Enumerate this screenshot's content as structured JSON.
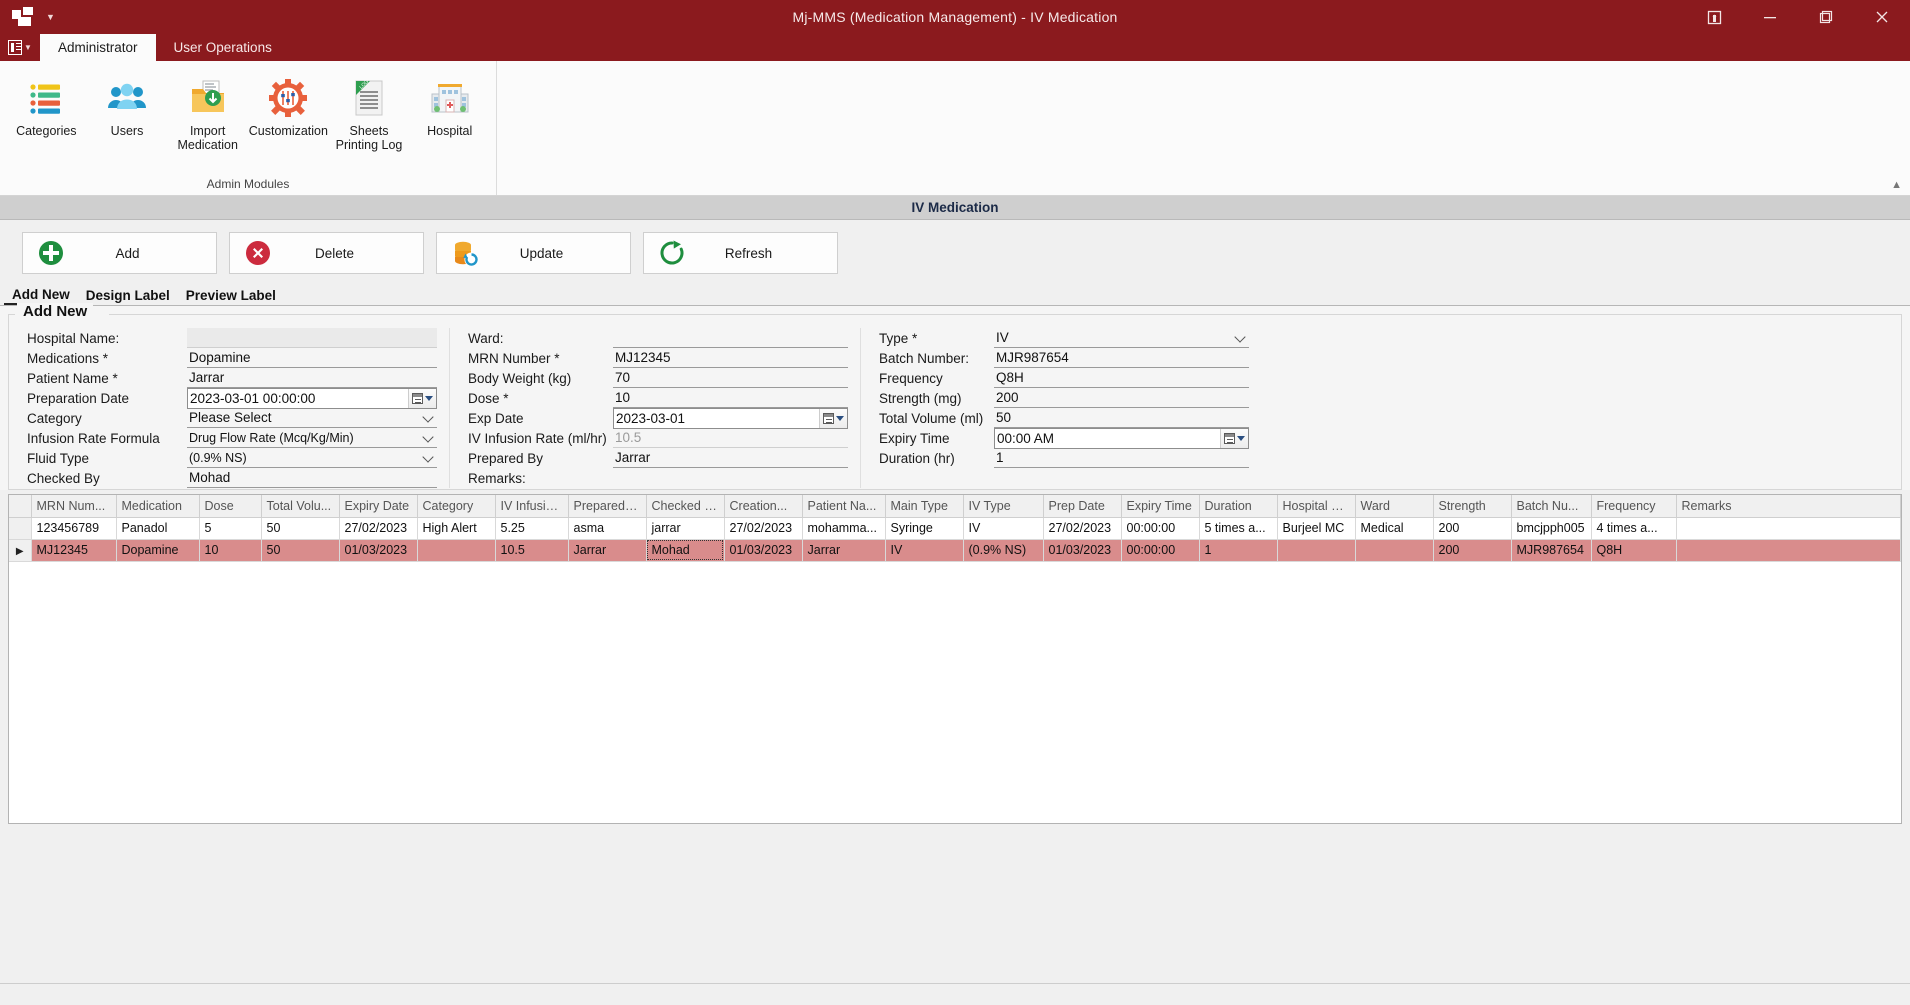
{
  "window": {
    "title": "Mj-MMS (Medication Management) - IV Medication",
    "controls": {
      "restore_down": "restore-down",
      "minimize": "minimize",
      "maximize": "maximize",
      "close": "close"
    }
  },
  "ribbon": {
    "tabs": [
      {
        "label": "Administrator",
        "active": true
      },
      {
        "label": "User Operations",
        "active": false
      }
    ],
    "group_title": "Admin Modules",
    "items": [
      {
        "label": "Categories",
        "icon": "categories-icon"
      },
      {
        "label": "Users",
        "icon": "users-icon"
      },
      {
        "label": "Import\nMedication",
        "line1": "Import",
        "line2": "Medication",
        "icon": "import-medication-icon"
      },
      {
        "label": "Customization",
        "icon": "customization-icon"
      },
      {
        "label": "Sheets\nPrinting Log",
        "line1": "Sheets",
        "line2": "Printing Log",
        "icon": "sheets-printing-log-icon"
      },
      {
        "label": "Hospital",
        "icon": "hospital-icon"
      }
    ]
  },
  "document": {
    "header": "IV Medication"
  },
  "actions": [
    {
      "label": "Add",
      "icon": "add-circle-icon"
    },
    {
      "label": "Delete",
      "icon": "delete-circle-icon"
    },
    {
      "label": "Update",
      "icon": "update-database-icon"
    },
    {
      "label": "Refresh",
      "icon": "refresh-icon"
    }
  ],
  "page_tabs": [
    {
      "label": "Add New",
      "active": true
    },
    {
      "label": "Design Label",
      "active": false
    },
    {
      "label": "Preview Label",
      "active": false
    }
  ],
  "form": {
    "legend": "Add New",
    "col1": [
      {
        "label": "Hospital Name:",
        "value": "",
        "type": "readonly"
      },
      {
        "label": "Medications *",
        "value": "Dopamine",
        "type": "text"
      },
      {
        "label": "Patient Name *",
        "value": "Jarrar",
        "type": "text"
      },
      {
        "label": "Preparation Date",
        "value": "2023-03-01 00:00:00",
        "type": "datetime"
      },
      {
        "label": "Category",
        "value": "Please Select",
        "type": "select"
      },
      {
        "label": "Infusion Rate Formula",
        "value": "Drug Flow Rate (Mcq/Kg/Min)",
        "type": "select-small"
      },
      {
        "label": "Fluid Type",
        "value": "(0.9% NS)",
        "type": "select-small"
      },
      {
        "label": "Checked By",
        "value": "Mohad",
        "type": "text"
      }
    ],
    "col2": [
      {
        "label": "Ward:",
        "value": "",
        "type": "text"
      },
      {
        "label": "MRN Number *",
        "value": "MJ12345",
        "type": "text"
      },
      {
        "label": "Body Weight (kg)",
        "value": "70",
        "type": "text"
      },
      {
        "label": "Dose *",
        "value": "10",
        "type": "text"
      },
      {
        "label": "Exp Date",
        "value": "2023-03-01",
        "type": "datetime"
      },
      {
        "label": "IV Infusion Rate (ml/hr)",
        "value": "10.5",
        "type": "disabled"
      },
      {
        "label": "Prepared By",
        "value": "Jarrar",
        "type": "text"
      },
      {
        "label": "Remarks:",
        "value": "",
        "type": "text"
      }
    ],
    "col3": [
      {
        "label": "Type *",
        "value": "IV",
        "type": "select"
      },
      {
        "label": "Batch Number:",
        "value": "MJR987654",
        "type": "text"
      },
      {
        "label": "Frequency",
        "value": "Q8H",
        "type": "text"
      },
      {
        "label": "Strength (mg)",
        "value": "200",
        "type": "text"
      },
      {
        "label": "Total Volume (ml)",
        "value": "50",
        "type": "text"
      },
      {
        "label": "Expiry Time",
        "value": "00:00 AM",
        "type": "datetime"
      },
      {
        "label": "Duration (hr)",
        "value": "1",
        "type": "text"
      }
    ]
  },
  "grid": {
    "columns": [
      "MRN Num...",
      "Medication",
      "Dose",
      "Total Volu...",
      "Expiry Date",
      "Category",
      "IV Infusio...",
      "Prepared By",
      "Checked By",
      "Creation...",
      "Patient Na...",
      "Main Type",
      "IV Type",
      "Prep Date",
      "Expiry Time",
      "Duration",
      "Hospital N...",
      "Ward",
      "Strength",
      "Batch Nu...",
      "Frequency",
      "Remarks"
    ],
    "rows": [
      {
        "selected": false,
        "marker": "",
        "cells": [
          "123456789",
          "Panadol",
          "5",
          "50",
          "27/02/2023",
          "High Alert",
          "5.25",
          "asma",
          "jarrar",
          "27/02/2023",
          "mohamma...",
          "Syringe",
          "IV",
          "27/02/2023",
          "00:00:00",
          "5 times a...",
          "Burjeel MC",
          "Medical",
          "200",
          "bmcjpph005",
          "4 times a...",
          ""
        ]
      },
      {
        "selected": true,
        "marker": "▶",
        "focus_cell_index": 8,
        "cells": [
          "MJ12345",
          "Dopamine",
          "10",
          "50",
          "01/03/2023",
          "",
          "10.5",
          "Jarrar",
          "Mohad",
          "01/03/2023",
          "Jarrar",
          "IV",
          "(0.9% NS)",
          "01/03/2023",
          "00:00:00",
          "1",
          "",
          "",
          "200",
          "MJR987654",
          "Q8H",
          ""
        ]
      }
    ]
  },
  "colors": {
    "brand": "#8B1A1E",
    "selected_row": "#d98c8c",
    "doc_header_bg": "#cfcfcf"
  }
}
